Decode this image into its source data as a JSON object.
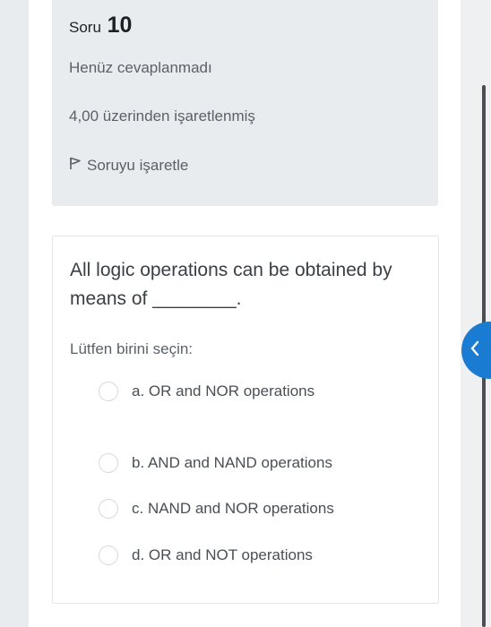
{
  "question": {
    "label": "Soru",
    "number": "10",
    "status": "Henüz cevaplanmadı",
    "grade": "4,00 üzerinden işaretlenmiş",
    "flag_label": "Soruyu işaretle"
  },
  "content": {
    "question_text": "All logic operations can be obtained by means of ________.",
    "prompt": "Lütfen birini seçin:",
    "options": [
      "a. OR and NOR operations",
      "b. AND and NAND operations",
      "c. NAND and NOR operations",
      "d. OR and NOT operations"
    ]
  },
  "colors": {
    "accent": "#1a7bd3",
    "info_box": "#e9ecef"
  },
  "icons": {
    "flag": "flag-icon",
    "drawer": "chevron-left-icon"
  }
}
